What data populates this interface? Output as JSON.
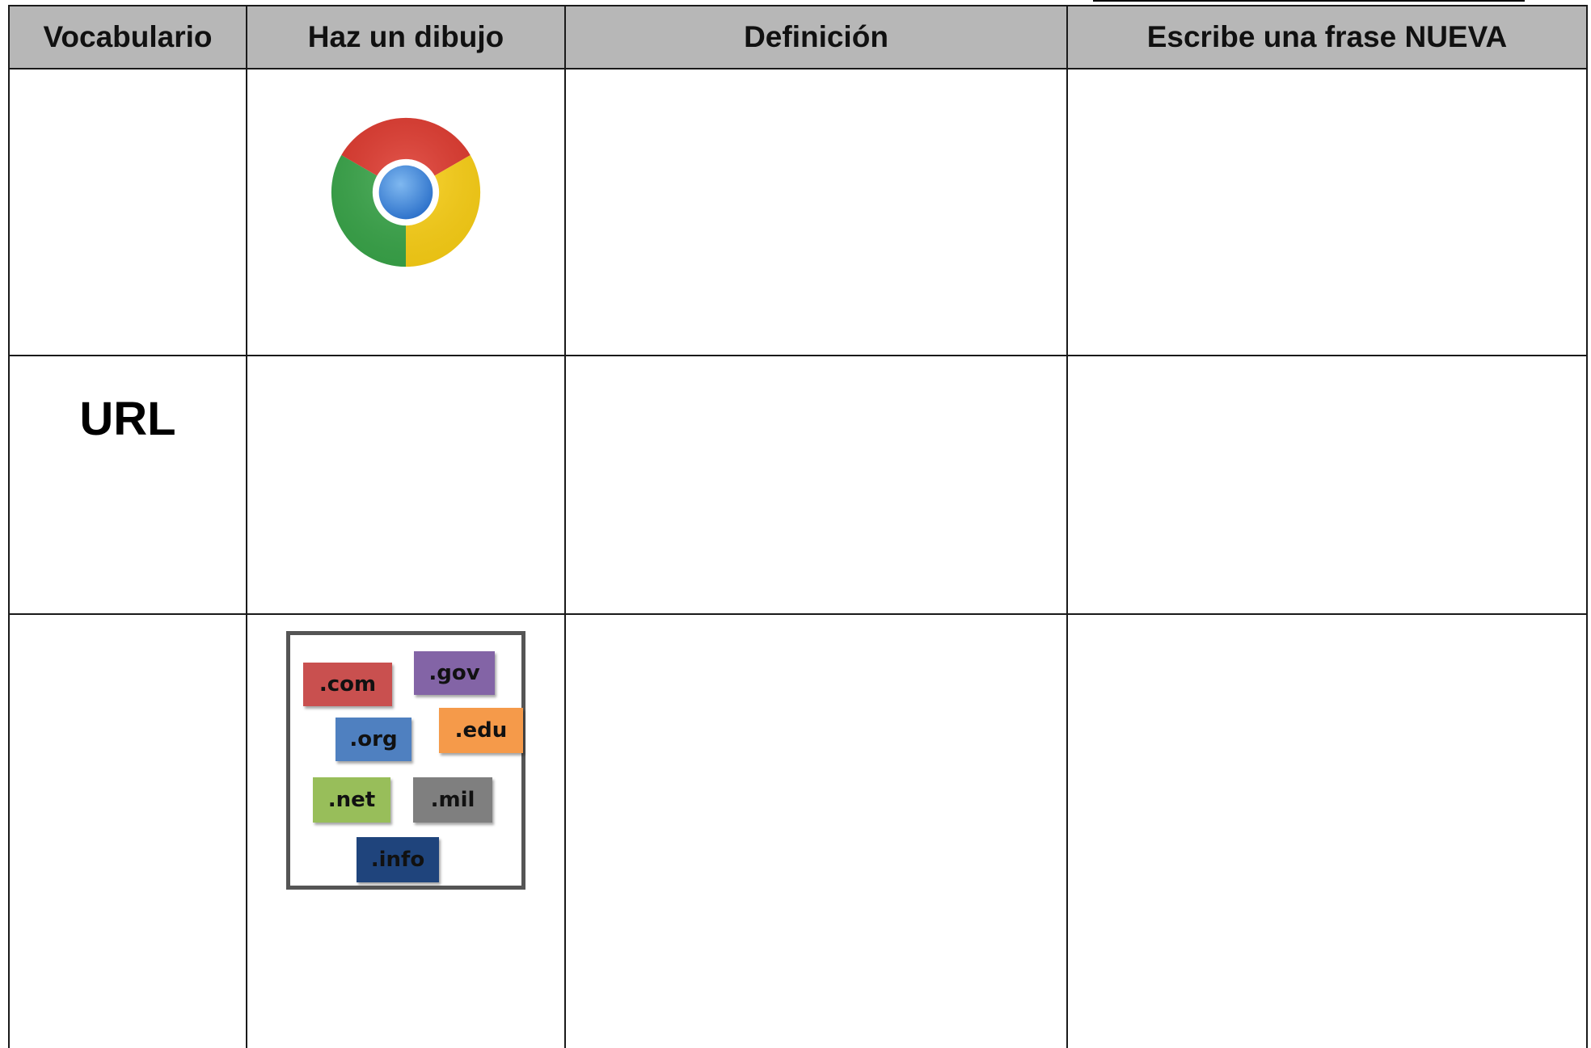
{
  "table": {
    "headers": [
      "Vocabulario",
      "Haz un dibujo",
      "Definición",
      "Escribe una frase NUEVA"
    ],
    "rows": [
      {
        "vocab": "",
        "drawing_icon": "chrome-logo-icon"
      },
      {
        "vocab": "URL",
        "drawing_icon": ""
      },
      {
        "vocab": "",
        "drawing_icon": "domain-extensions-image"
      }
    ]
  },
  "tld_tags": [
    {
      "label": ".com",
      "color": "#c9504f"
    },
    {
      "label": ".gov",
      "color": "#8364a6"
    },
    {
      "label": ".org",
      "color": "#4f80c0"
    },
    {
      "label": ".edu",
      "color": "#f59a4a"
    },
    {
      "label": ".net",
      "color": "#98be5a"
    },
    {
      "label": ".mil",
      "color": "#7f7f7f"
    },
    {
      "label": ".info",
      "color": "#1f447c"
    }
  ],
  "colors": {
    "header_bg": "#b7b7b7",
    "border": "#1a1a1a"
  }
}
